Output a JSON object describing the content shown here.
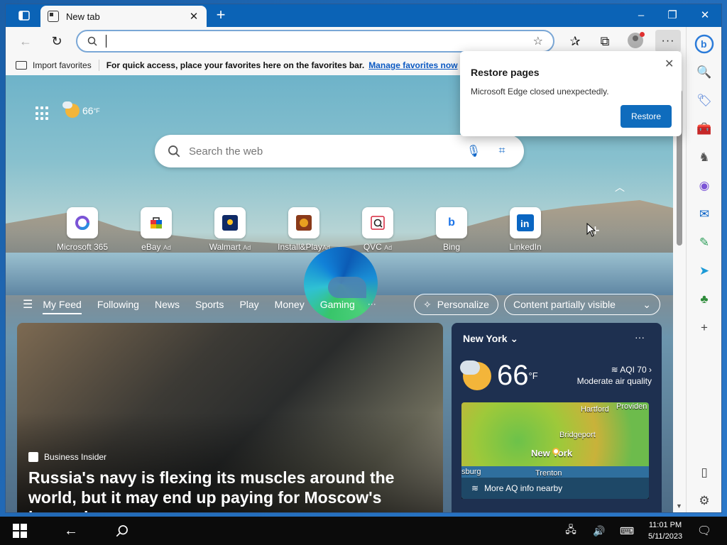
{
  "tab": {
    "title": "New tab"
  },
  "address": {
    "placeholder": ""
  },
  "favbar": {
    "import_label": "Import favorites",
    "message": "For quick access, place your favorites here on the favorites bar.",
    "manage_link": "Manage favorites now"
  },
  "weather_mini": {
    "temp": "66",
    "unit": "°F"
  },
  "search": {
    "placeholder": "Search the web"
  },
  "quicklinks": [
    {
      "name": "Microsoft 365",
      "ad": ""
    },
    {
      "name": "eBay",
      "ad": "Ad"
    },
    {
      "name": "Walmart",
      "ad": "Ad"
    },
    {
      "name": "Install&Play",
      "ad": "Ad"
    },
    {
      "name": "QVC",
      "ad": "Ad"
    },
    {
      "name": "Bing",
      "ad": ""
    },
    {
      "name": "LinkedIn",
      "ad": ""
    }
  ],
  "feed": {
    "tabs": [
      "My Feed",
      "Following",
      "News",
      "Sports",
      "Play",
      "Money",
      "Gaming"
    ],
    "more": "···",
    "personalize": "Personalize",
    "visibility": "Content partially visible"
  },
  "news": {
    "source": "Business Insider",
    "headline": "Russia's navy is flexing its muscles around the world, but it may end up paying for Moscow's losses in..."
  },
  "weather_card": {
    "location": "New York",
    "temp": "66",
    "unit": "°F",
    "aqi": "AQI 70",
    "aqi_desc": "Moderate air quality",
    "map_labels": [
      "Hartford",
      "Providen",
      "Bridgeport",
      "New York",
      "sburg",
      "Trenton"
    ],
    "footer": "More AQ info nearby"
  },
  "popup": {
    "title": "Restore pages",
    "message": "Microsoft Edge closed unexpectedly.",
    "button": "Restore"
  },
  "taskbar": {
    "time": "11:01 PM",
    "date": "5/11/2023"
  },
  "colors": {
    "accent": "#0f6cbd",
    "titlebar": "#0b63b6",
    "taskbar": "#0b0b0b"
  }
}
